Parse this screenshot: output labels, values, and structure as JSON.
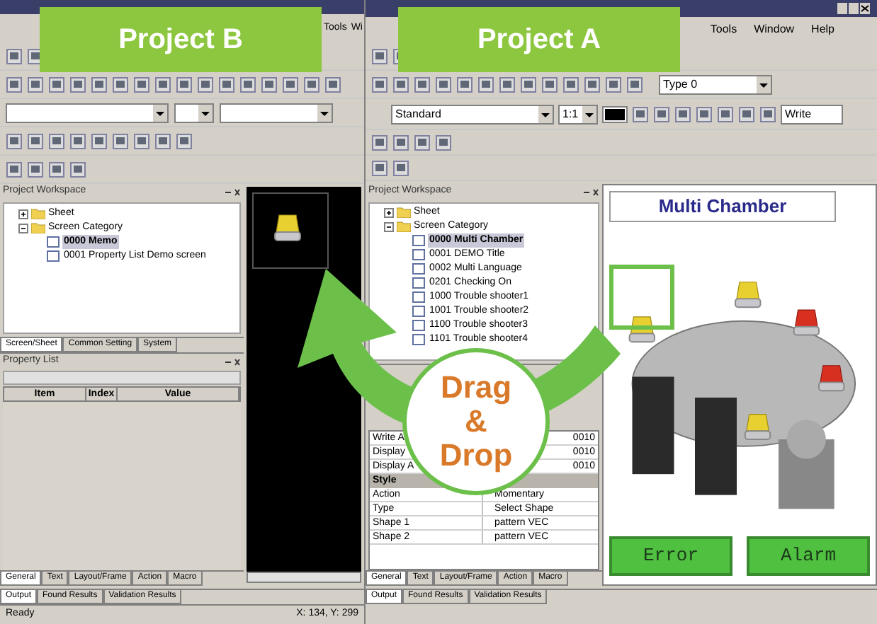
{
  "project_b": {
    "banner": "Project B",
    "menu": [
      "Tools",
      "Wi"
    ],
    "workspace": {
      "title": "Project Workspace",
      "tree": [
        {
          "label": "Sheet",
          "expanded": false
        },
        {
          "label": "Screen Category",
          "expanded": true,
          "children": [
            {
              "label": "0000 Memo",
              "selected": true
            },
            {
              "label": "0001 Property List Demo screen",
              "selected": false
            }
          ]
        }
      ],
      "tabs": [
        {
          "label": "Screen/Sheet",
          "selected": true
        },
        {
          "label": "Common Setting",
          "selected": false
        },
        {
          "label": "System",
          "selected": false
        }
      ]
    },
    "property_list": {
      "title": "Property List",
      "columns": [
        "Item",
        "Index",
        "Value"
      ],
      "tabs": [
        {
          "label": "General",
          "selected": true
        },
        {
          "label": "Text",
          "selected": false
        },
        {
          "label": "Layout/Frame",
          "selected": false
        },
        {
          "label": "Action",
          "selected": false
        },
        {
          "label": "Macro",
          "selected": false
        }
      ]
    },
    "output_tabs": [
      {
        "label": "Output",
        "selected": true
      },
      {
        "label": "Found Results",
        "selected": false
      },
      {
        "label": "Validation Results",
        "selected": false
      }
    ],
    "status": {
      "left": "Ready",
      "right": "X: 134, Y: 299"
    }
  },
  "project_a": {
    "banner": "Project A",
    "menu": [
      "Tools",
      "Window",
      "Help"
    ],
    "type_select": "Type 0",
    "style_select": "Standard",
    "zoom_select": "1:1",
    "write_field": "Write",
    "workspace": {
      "title": "Project Workspace",
      "tree": [
        {
          "label": "Sheet",
          "expanded": false
        },
        {
          "label": "Screen Category",
          "expanded": true,
          "children": [
            {
              "label": "0000 Multi Chamber",
              "selected": true
            },
            {
              "label": "0001 DEMO Title",
              "selected": false
            },
            {
              "label": "0002 Multi Language",
              "selected": false
            },
            {
              "label": "0201 Checking On",
              "selected": false
            },
            {
              "label": "1000 Trouble shooter1",
              "selected": false
            },
            {
              "label": "1001 Trouble shooter2",
              "selected": false
            },
            {
              "label": "1100 Trouble shooter3",
              "selected": false
            },
            {
              "label": "1101 Trouble shooter4",
              "selected": false
            }
          ]
        }
      ]
    },
    "properties": [
      {
        "item": "Write A",
        "value": "0010",
        "kind": "partial"
      },
      {
        "item": "Display",
        "value": "0010",
        "kind": "partial"
      },
      {
        "item": "Display A",
        "value": "0010",
        "kind": "partial"
      },
      {
        "item": "Style",
        "kind": "section"
      },
      {
        "item": "Action",
        "value": "Momentary",
        "kind": "row"
      },
      {
        "item": "Type",
        "value": "Select Shape",
        "kind": "row"
      },
      {
        "item": "Shape 1",
        "value": "pattern VEC",
        "kind": "row"
      },
      {
        "item": "Shape 2",
        "value": "pattern VEC",
        "kind": "row"
      }
    ],
    "property_tabs": [
      {
        "label": "General",
        "selected": true
      },
      {
        "label": "Text",
        "selected": false
      },
      {
        "label": "Layout/Frame",
        "selected": false
      },
      {
        "label": "Action",
        "selected": false
      },
      {
        "label": "Macro",
        "selected": false
      }
    ],
    "output_tabs": [
      {
        "label": "Output",
        "selected": true
      },
      {
        "label": "Found Results",
        "selected": false
      },
      {
        "label": "Validation Results",
        "selected": false
      }
    ],
    "canvas": {
      "title": "Multi Chamber",
      "buttons": [
        "Error",
        "Alarm"
      ]
    }
  },
  "callout": {
    "lines": [
      "Drag",
      "&",
      "Drop"
    ]
  }
}
